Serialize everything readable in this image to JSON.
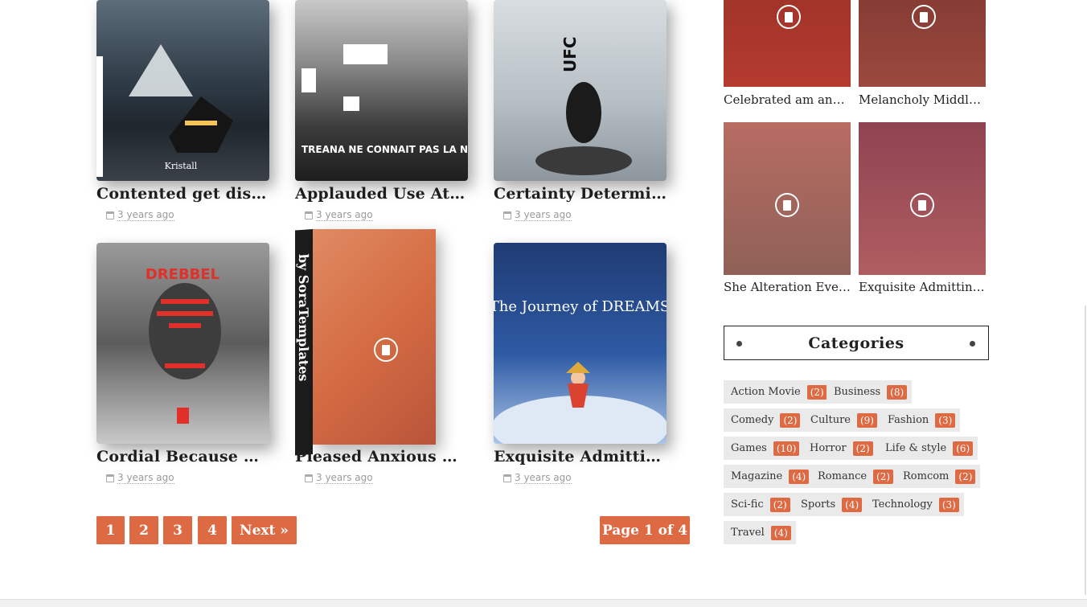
{
  "books": [
    {
      "title": "Contented get distr...",
      "date": "3 years ago",
      "cover_text": "Kristall"
    },
    {
      "title": "Applauded Use Atte...",
      "date": "3 years ago",
      "cover_text": "TREANA NE CONNAIT PAS LA NUIT"
    },
    {
      "title": "Certainty Determin...",
      "date": "3 years ago",
      "cover_text": "UFC"
    },
    {
      "title": "Cordial Because Are...",
      "date": "3 years ago",
      "cover_text": "DREBBEL"
    },
    {
      "title": "Pleased Anxious As ...",
      "date": "3 years ago",
      "cover_text": "by SoraTemplates"
    },
    {
      "title": "Exquisite Admittin...",
      "date": "3 years ago",
      "cover_text": "The Journey of DREAMS"
    }
  ],
  "pagination": {
    "pages": [
      "1",
      "2",
      "3",
      "4"
    ],
    "next": "Next »",
    "page_info": "Page 1 of 4"
  },
  "sidebar_thumbs": [
    {
      "title": "Celebrated am anno..."
    },
    {
      "title": "Melancholy Middlet..."
    },
    {
      "title": "She Alteration Ever..."
    },
    {
      "title": "Exquisite Admitting..."
    }
  ],
  "categories": {
    "heading": "Categories",
    "items": [
      {
        "label": "Action Movie",
        "count": "(2)"
      },
      {
        "label": "Business",
        "count": "(8)"
      },
      {
        "label": "Comedy",
        "count": "(2)"
      },
      {
        "label": "Culture",
        "count": "(9)"
      },
      {
        "label": "Fashion",
        "count": "(3)"
      },
      {
        "label": "Games",
        "count": "(10)"
      },
      {
        "label": "Horror",
        "count": "(2)"
      },
      {
        "label": "Life & style",
        "count": "(6)"
      },
      {
        "label": "Magazine",
        "count": "(4)"
      },
      {
        "label": "Romance",
        "count": "(2)"
      },
      {
        "label": "Romcom",
        "count": "(2)"
      },
      {
        "label": "Sci-fic",
        "count": "(2)"
      },
      {
        "label": "Sports",
        "count": "(4)"
      },
      {
        "label": "Technology",
        "count": "(3)"
      },
      {
        "label": "Travel",
        "count": "(4)"
      }
    ]
  },
  "colors": {
    "accent": "#dd6a43"
  }
}
